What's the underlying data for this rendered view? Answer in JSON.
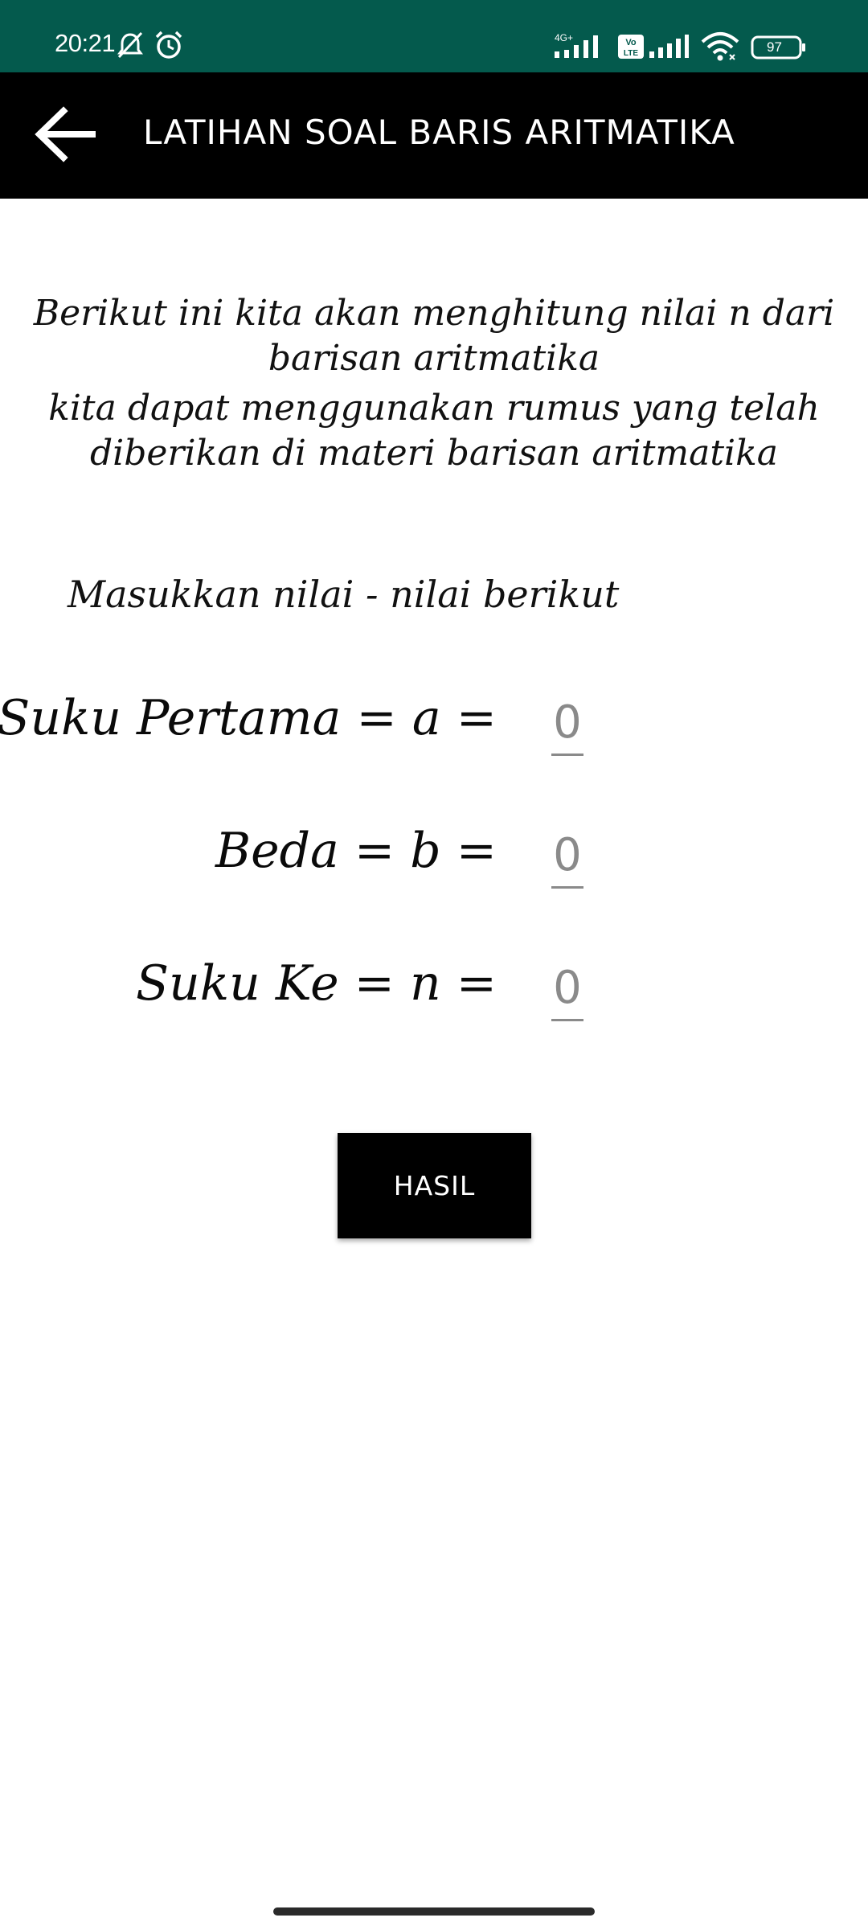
{
  "status_bar": {
    "time": "20:21",
    "battery": "97",
    "network_type_1": "4G+",
    "network_type_2": "Vo LTE",
    "icons": [
      "bell-off-icon",
      "alarm-icon",
      "signal-icon",
      "volte-icon",
      "signal-icon",
      "wifi-icon",
      "battery-icon"
    ],
    "color": "#045a4d"
  },
  "app_bar": {
    "title": "LATIHAN SOAL BARIS ARITMATIKA",
    "back_icon": "arrow-left-icon",
    "color": "#000000"
  },
  "intro": {
    "paragraph_1": "Berikut ini kita akan menghitung nilai n dari barisan aritmatika",
    "paragraph_2": "kita dapat menggunakan rumus yang telah diberikan di materi barisan aritmatika"
  },
  "prompt": "Masukkan nilai - nilai berikut",
  "fields": [
    {
      "label": "Suku Pertama = a =",
      "placeholder": "0"
    },
    {
      "label": "Beda = b =",
      "placeholder": "0"
    },
    {
      "label": "Suku Ke = n =",
      "placeholder": "0"
    }
  ],
  "button": {
    "label": "HASIL"
  }
}
